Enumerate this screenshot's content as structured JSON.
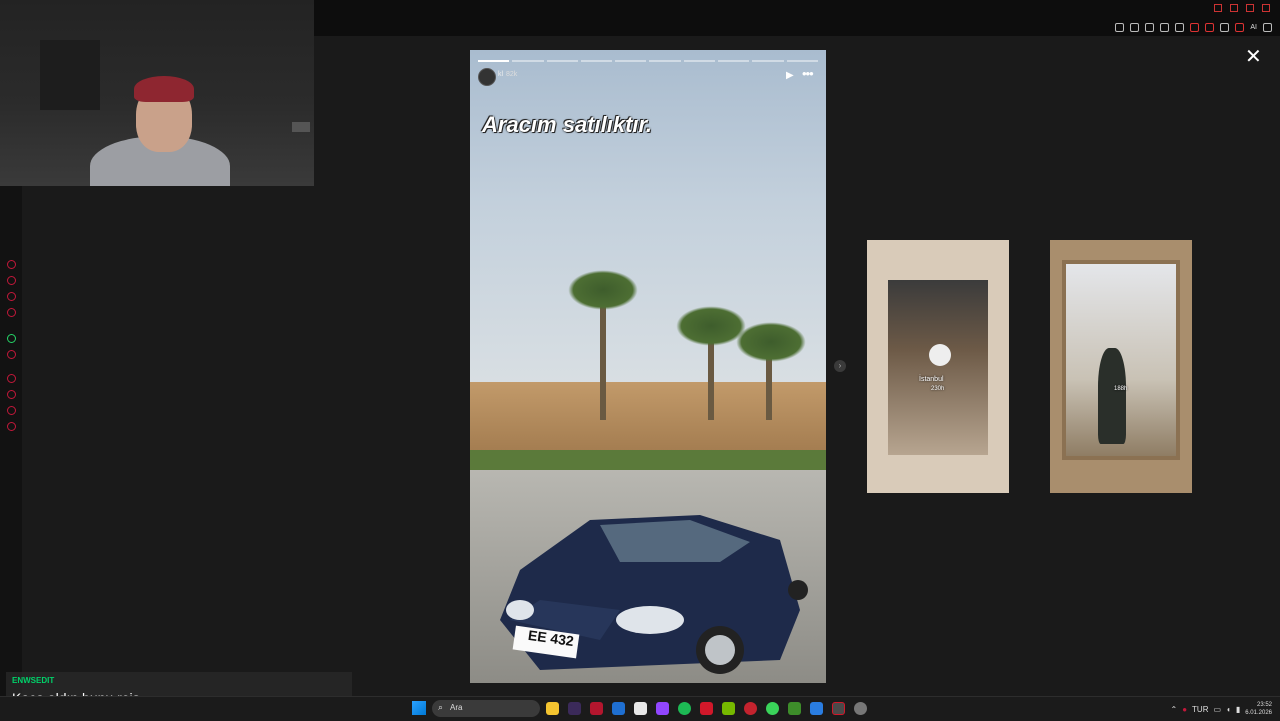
{
  "story": {
    "username": "kl",
    "time": "82k",
    "caption": "Aracım satılıktır.",
    "plate": "EE 432",
    "progress_total": 10,
    "progress_active": 1
  },
  "preview_cards": [
    {
      "label": "İstanbul",
      "sub": "230h"
    },
    {
      "label": "",
      "sub": "188h"
    }
  ],
  "chat": {
    "username": "ENWSEDIT",
    "message": "Kaça aldın bunu reis"
  },
  "taskbar": {
    "search_placeholder": "Ara",
    "tray_lang": "TUR",
    "clock_time": "23:52",
    "clock_date": "6.01.2026"
  },
  "browser": {
    "ai_label": "AI"
  },
  "colors": {
    "accent": "#c2183a",
    "chat_user": "#00d26a"
  },
  "icons": {
    "close": "close-icon",
    "play": "play-icon",
    "more": "more-icon",
    "next": "chevron-right-icon"
  }
}
